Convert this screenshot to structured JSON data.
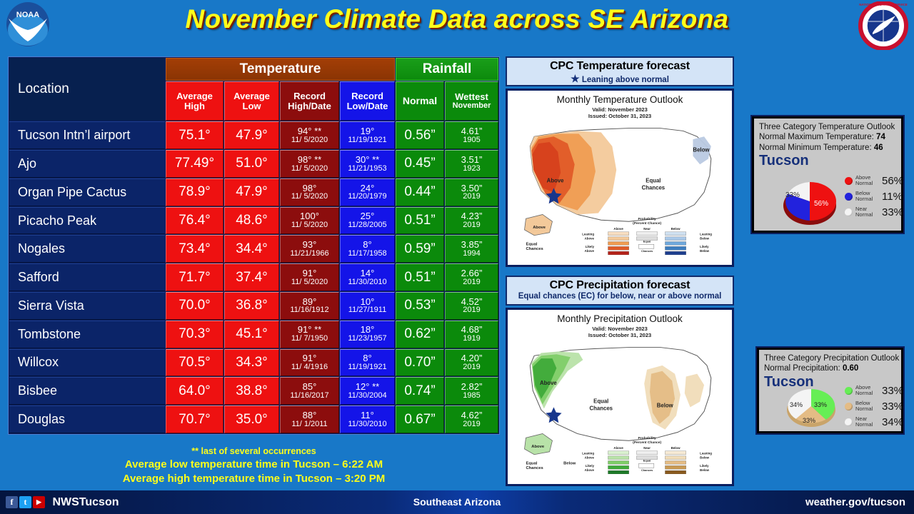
{
  "header": {
    "title": "November Climate Data across SE Arizona",
    "noaa_logo_text": "NOAA",
    "nws_logo_alt": "National Weather Service"
  },
  "table": {
    "group_headers": {
      "location": "Location",
      "temperature": "Temperature",
      "rainfall": "Rainfall"
    },
    "columns": {
      "avg_high": "Average High",
      "avg_high_l1": "Average",
      "avg_high_l2": "High",
      "avg_low_l1": "Average",
      "avg_low_l2": "Low",
      "rec_high_l1": "Record",
      "rec_high_l2": "High/Date",
      "rec_low_l1": "Record",
      "rec_low_l2": "Low/Date",
      "normal": "Normal",
      "wettest_l1": "Wettest",
      "wettest_l2": "November"
    },
    "rows": [
      {
        "location": "Tucson Intn’l airport",
        "avg_high": "75.1°",
        "avg_low": "47.9°",
        "rec_high": "94° **",
        "rec_high_date": "11/ 5/2020",
        "rec_low": "19°",
        "rec_low_date": "11/19/1921",
        "normal": "0.56”",
        "wettest": "4.61”",
        "wettest_year": "1905"
      },
      {
        "location": "Ajo",
        "avg_high": "77.49°",
        "avg_low": "51.0°",
        "rec_high": "98° **",
        "rec_high_date": "11/ 5/2020",
        "rec_low": "30° **",
        "rec_low_date": "11/21/1953",
        "normal": "0.45”",
        "wettest": "3.51”",
        "wettest_year": "1923"
      },
      {
        "location": "Organ Pipe Cactus",
        "avg_high": "78.9°",
        "avg_low": "47.9°",
        "rec_high": "98°",
        "rec_high_date": "11/ 5/2020",
        "rec_low": "24°",
        "rec_low_date": "11/20/1979",
        "normal": "0.44”",
        "wettest": "3.50”",
        "wettest_year": "2019"
      },
      {
        "location": "Picacho Peak",
        "avg_high": "76.4°",
        "avg_low": "48.6°",
        "rec_high": "100°",
        "rec_high_date": "11/ 5/2020",
        "rec_low": "25°",
        "rec_low_date": "11/28/2005",
        "normal": "0.51”",
        "wettest": "4.23”",
        "wettest_year": "2019"
      },
      {
        "location": "Nogales",
        "avg_high": "73.4°",
        "avg_low": "34.4°",
        "rec_high": "93°",
        "rec_high_date": "11/21/1966",
        "rec_low": "8°",
        "rec_low_date": "11/17/1958",
        "normal": "0.59”",
        "wettest": "3.85”",
        "wettest_year": "1994"
      },
      {
        "location": "Safford",
        "avg_high": "71.7°",
        "avg_low": "37.4°",
        "rec_high": "91°",
        "rec_high_date": "11/ 5/2020",
        "rec_low": "14°",
        "rec_low_date": "11/30/2010",
        "normal": "0.51”",
        "wettest": "2.66”",
        "wettest_year": "2019"
      },
      {
        "location": "Sierra Vista",
        "avg_high": "70.0°",
        "avg_low": "36.8°",
        "rec_high": "89°",
        "rec_high_date": "11/16/1912",
        "rec_low": "10°",
        "rec_low_date": "11/27/1911",
        "normal": "0.53”",
        "wettest": "4.52”",
        "wettest_year": "2019"
      },
      {
        "location": "Tombstone",
        "avg_high": "70.3°",
        "avg_low": "45.1°",
        "rec_high": "91° **",
        "rec_high_date": "11/ 7/1950",
        "rec_low": "18°",
        "rec_low_date": "11/23/1957",
        "normal": "0.62”",
        "wettest": "4.68”",
        "wettest_year": "1919"
      },
      {
        "location": "Willcox",
        "avg_high": "70.5°",
        "avg_low": "34.3°",
        "rec_high": "91°",
        "rec_high_date": "11/ 4/1916",
        "rec_low": "8°",
        "rec_low_date": "11/19/1921",
        "normal": "0.70”",
        "wettest": "4.20”",
        "wettest_year": "2019"
      },
      {
        "location": "Bisbee",
        "avg_high": "64.0°",
        "avg_low": "38.8°",
        "rec_high": "85°",
        "rec_high_date": "11/16/2017",
        "rec_low": "12° **",
        "rec_low_date": "11/30/2004",
        "normal": "0.74”",
        "wettest": "2.82”",
        "wettest_year": "1985"
      },
      {
        "location": "Douglas",
        "avg_high": "70.7°",
        "avg_low": "35.0°",
        "rec_high": "88°",
        "rec_high_date": "11/ 1/2011",
        "rec_low": "11°",
        "rec_low_date": "11/30/2010",
        "normal": "0.67”",
        "wettest": "4.62”",
        "wettest_year": "2019"
      }
    ]
  },
  "footnotes": {
    "star_note": "** last of several occurrences",
    "line1": "Average low temperature time in Tucson – 6:22 AM",
    "line2": "Average high temperature time in Tucson – 3:20 PM"
  },
  "cpc_temperature": {
    "panel_title": "CPC Temperature forecast",
    "panel_sub": "Leaning above normal",
    "map_title": "Monthly Temperature Outlook",
    "map_valid": "Valid:  November 2023",
    "map_issued": "Issued:  October 31, 2023",
    "map_labels": {
      "above": "Above",
      "below": "Below",
      "equal": "Equal Chances",
      "probability": "Probability (Percent Chance)"
    }
  },
  "cpc_precipitation": {
    "panel_title": "CPC Precipitation forecast",
    "panel_sub": "Equal chances (EC) for below, near or above normal",
    "map_title": "Monthly Precipitation Outlook",
    "map_valid": "Valid:  November 2023",
    "map_issued": "Issued:  October 31, 2023",
    "map_labels": {
      "above": "Above",
      "below": "Below",
      "equal": "Equal Chances",
      "probability": "Probability (Percent Chance)"
    }
  },
  "temp_outlook_panel": {
    "title": "Three Category Temperature Outlook",
    "normal_max_label": "Normal Maximum Temperature:",
    "normal_max_value": "74",
    "normal_min_label": "Normal Minimum Temperature:",
    "normal_min_value": "46",
    "city": "Tucson"
  },
  "precip_outlook_panel": {
    "title": "Three Category Precipitation Outlook",
    "normal_precip_label": "Normal Precipitation:",
    "normal_precip_value": "0.60",
    "city": "Tucson"
  },
  "footer": {
    "handle": "NWSTucson",
    "center": "Southeast Arizona",
    "website": "weather.gov/tucson",
    "facebook_icon": "f",
    "twitter_icon": "t",
    "youtube_icon": "▶"
  },
  "chart_data": [
    {
      "type": "pie",
      "title": "Three Category Temperature Outlook",
      "subtitle": "Tucson",
      "categories": [
        "Above Normal",
        "Below Normal",
        "Near Normal"
      ],
      "values": [
        56,
        11,
        33
      ],
      "labels": [
        "56%",
        "11%",
        "33%"
      ],
      "slice_labels": [
        "56%",
        "",
        "33%"
      ],
      "colors": [
        "#ee1111",
        "#2222dd",
        "#f2f2f2"
      ],
      "legend_position": "right",
      "units": "percent",
      "annotations": {
        "Normal Maximum Temperature": 74,
        "Normal Minimum Temperature": 46
      }
    },
    {
      "type": "pie",
      "title": "Three Category Precipitation Outlook",
      "subtitle": "Tucson",
      "categories": [
        "Above Normal",
        "Below Normal",
        "Near Normal"
      ],
      "values": [
        33,
        33,
        34
      ],
      "labels": [
        "33%",
        "33%",
        "34%"
      ],
      "slice_labels": [
        "33%",
        "33%",
        "34%"
      ],
      "colors": [
        "#66ee55",
        "#e4bc85",
        "#f2f2f2"
      ],
      "legend_position": "right",
      "units": "percent",
      "annotations": {
        "Normal Precipitation": 0.6
      }
    }
  ]
}
